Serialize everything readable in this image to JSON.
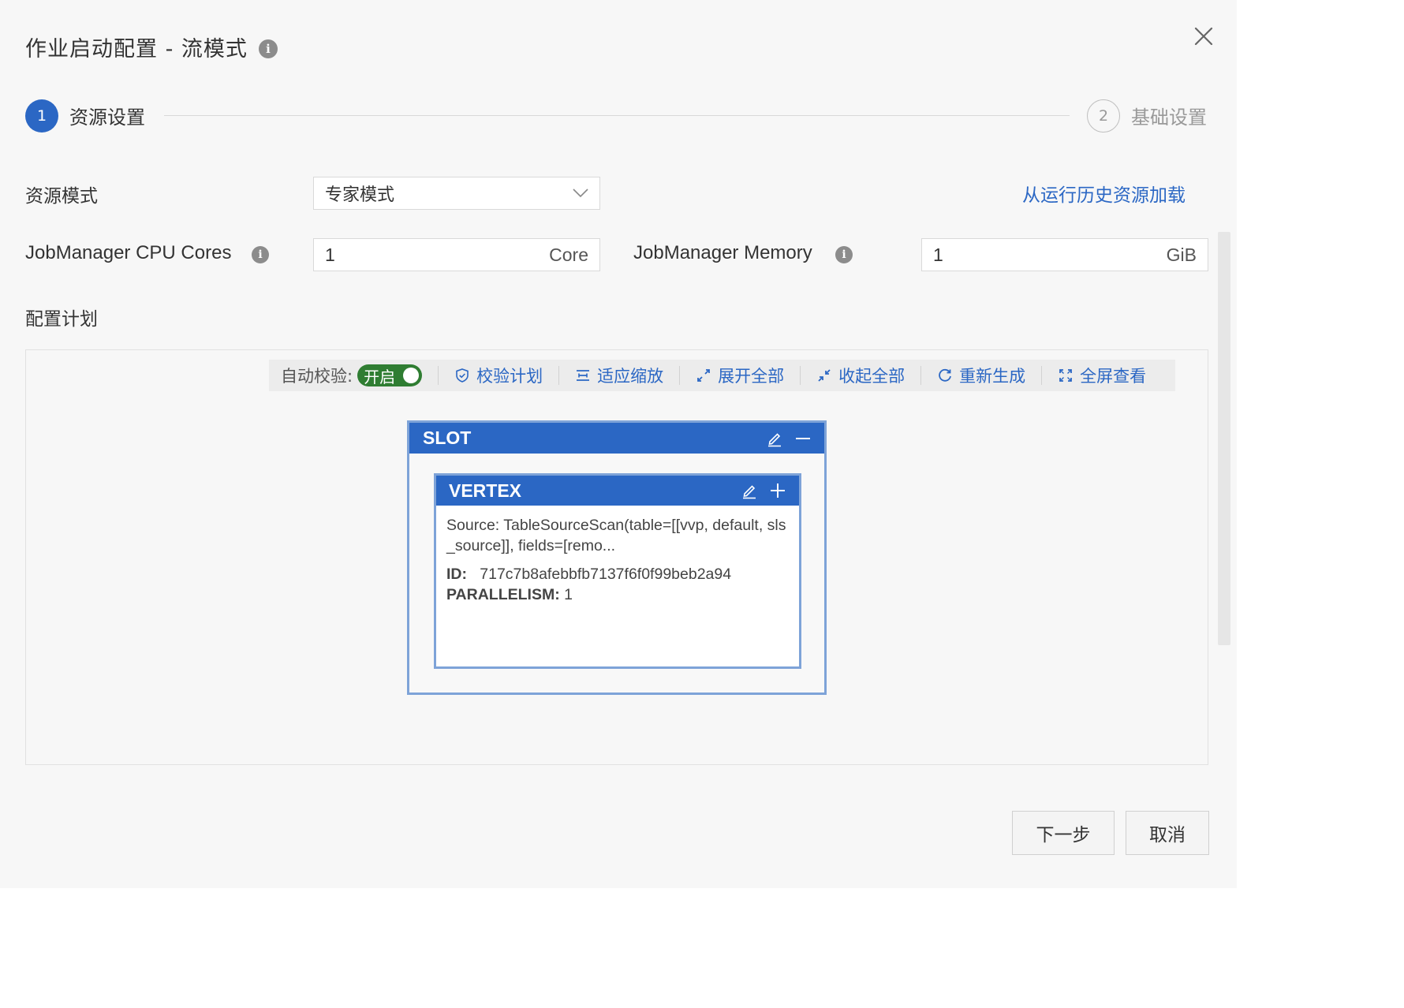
{
  "dialog": {
    "title": "作业启动配置 - 流模式",
    "close_icon": "close-icon"
  },
  "steps": [
    {
      "number": "1",
      "label": "资源设置",
      "active": true
    },
    {
      "number": "2",
      "label": "基础设置",
      "active": false
    }
  ],
  "form": {
    "resource_mode_label": "资源模式",
    "resource_mode_value": "专家模式",
    "load_history_link": "从运行历史资源加载",
    "jm_cpu_label": "JobManager CPU Cores",
    "jm_cpu_value": "1",
    "jm_cpu_unit": "Core",
    "jm_memory_label": "JobManager Memory",
    "jm_memory_value": "1",
    "jm_memory_unit": "GiB",
    "plan_label": "配置计划"
  },
  "toolbar": {
    "auto_validate_label": "自动校验:",
    "toggle_label": "开启",
    "toggle_on": true,
    "buttons": [
      {
        "label": "校验计划",
        "icon": "shield-check-icon"
      },
      {
        "label": "适应缩放",
        "icon": "fit-zoom-icon"
      },
      {
        "label": "展开全部",
        "icon": "expand-icon"
      },
      {
        "label": "收起全部",
        "icon": "collapse-icon"
      },
      {
        "label": "重新生成",
        "icon": "refresh-icon"
      },
      {
        "label": "全屏查看",
        "icon": "fullscreen-icon"
      }
    ]
  },
  "slot": {
    "title": "SLOT",
    "vertex": {
      "title": "VERTEX",
      "source": "Source: TableSourceScan(table=[[vvp, default, sls_source]], fields=[remo...",
      "id_key": "ID:",
      "id_value": "717c7b8afebbfb7137f6f0f99beb2a94",
      "parallelism_key": "PARALLELISM:",
      "parallelism_value": "1"
    }
  },
  "footer": {
    "next_label": "下一步",
    "cancel_label": "取消"
  },
  "colors": {
    "primary": "#2b67c4",
    "toggle_on": "#2f7d32",
    "node_border": "#7ea3d8"
  }
}
